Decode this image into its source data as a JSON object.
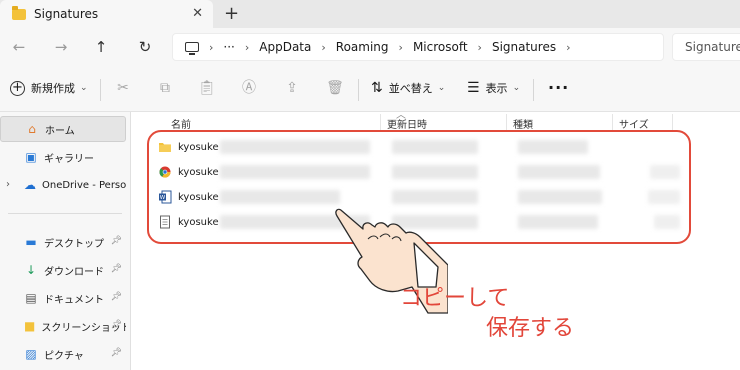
{
  "window": {
    "tab_title": "Signatures",
    "tab_close": "✕",
    "new_tab": "+"
  },
  "nav": {
    "back": "←",
    "forward": "→",
    "up": "↑",
    "refresh": "↻"
  },
  "address": {
    "more": "···",
    "breadcrumbs": [
      "AppData",
      "Roaming",
      "Microsoft",
      "Signatures"
    ],
    "search_placeholder": "Signatures"
  },
  "toolbar": {
    "new_label": "新規作成",
    "sort_label": "並べ替え",
    "view_label": "表示",
    "more_label": "···"
  },
  "sidebar": {
    "items": [
      {
        "label": "ホーム",
        "icon": "home-icon"
      },
      {
        "label": "ギャラリー",
        "icon": "gallery-icon"
      },
      {
        "label": "OneDrive - Persor",
        "icon": "cloud-icon"
      },
      {
        "label": "デスクトップ",
        "icon": "desktop-icon"
      },
      {
        "label": "ダウンロード",
        "icon": "download-icon"
      },
      {
        "label": "ドキュメント",
        "icon": "document-icon"
      },
      {
        "label": "スクリーンショット",
        "icon": "folder-icon"
      },
      {
        "label": "ピクチャ",
        "icon": "pictures-icon"
      }
    ]
  },
  "columns": {
    "name": "名前",
    "modified": "更新日時",
    "type": "種類",
    "size": "サイズ"
  },
  "files": [
    {
      "name": "kyosuke",
      "icon": "folder-icon"
    },
    {
      "name": "kyosuke",
      "icon": "html-file-icon"
    },
    {
      "name": "kyosuke",
      "icon": "word-file-icon"
    },
    {
      "name": "kyosuke",
      "icon": "text-file-icon"
    }
  ],
  "annotation": {
    "line1": "コピーして",
    "line2": "保存する"
  },
  "colors": {
    "highlight": "#e24a3a",
    "folder": "#f3c23b",
    "accent": "#0067c0"
  }
}
